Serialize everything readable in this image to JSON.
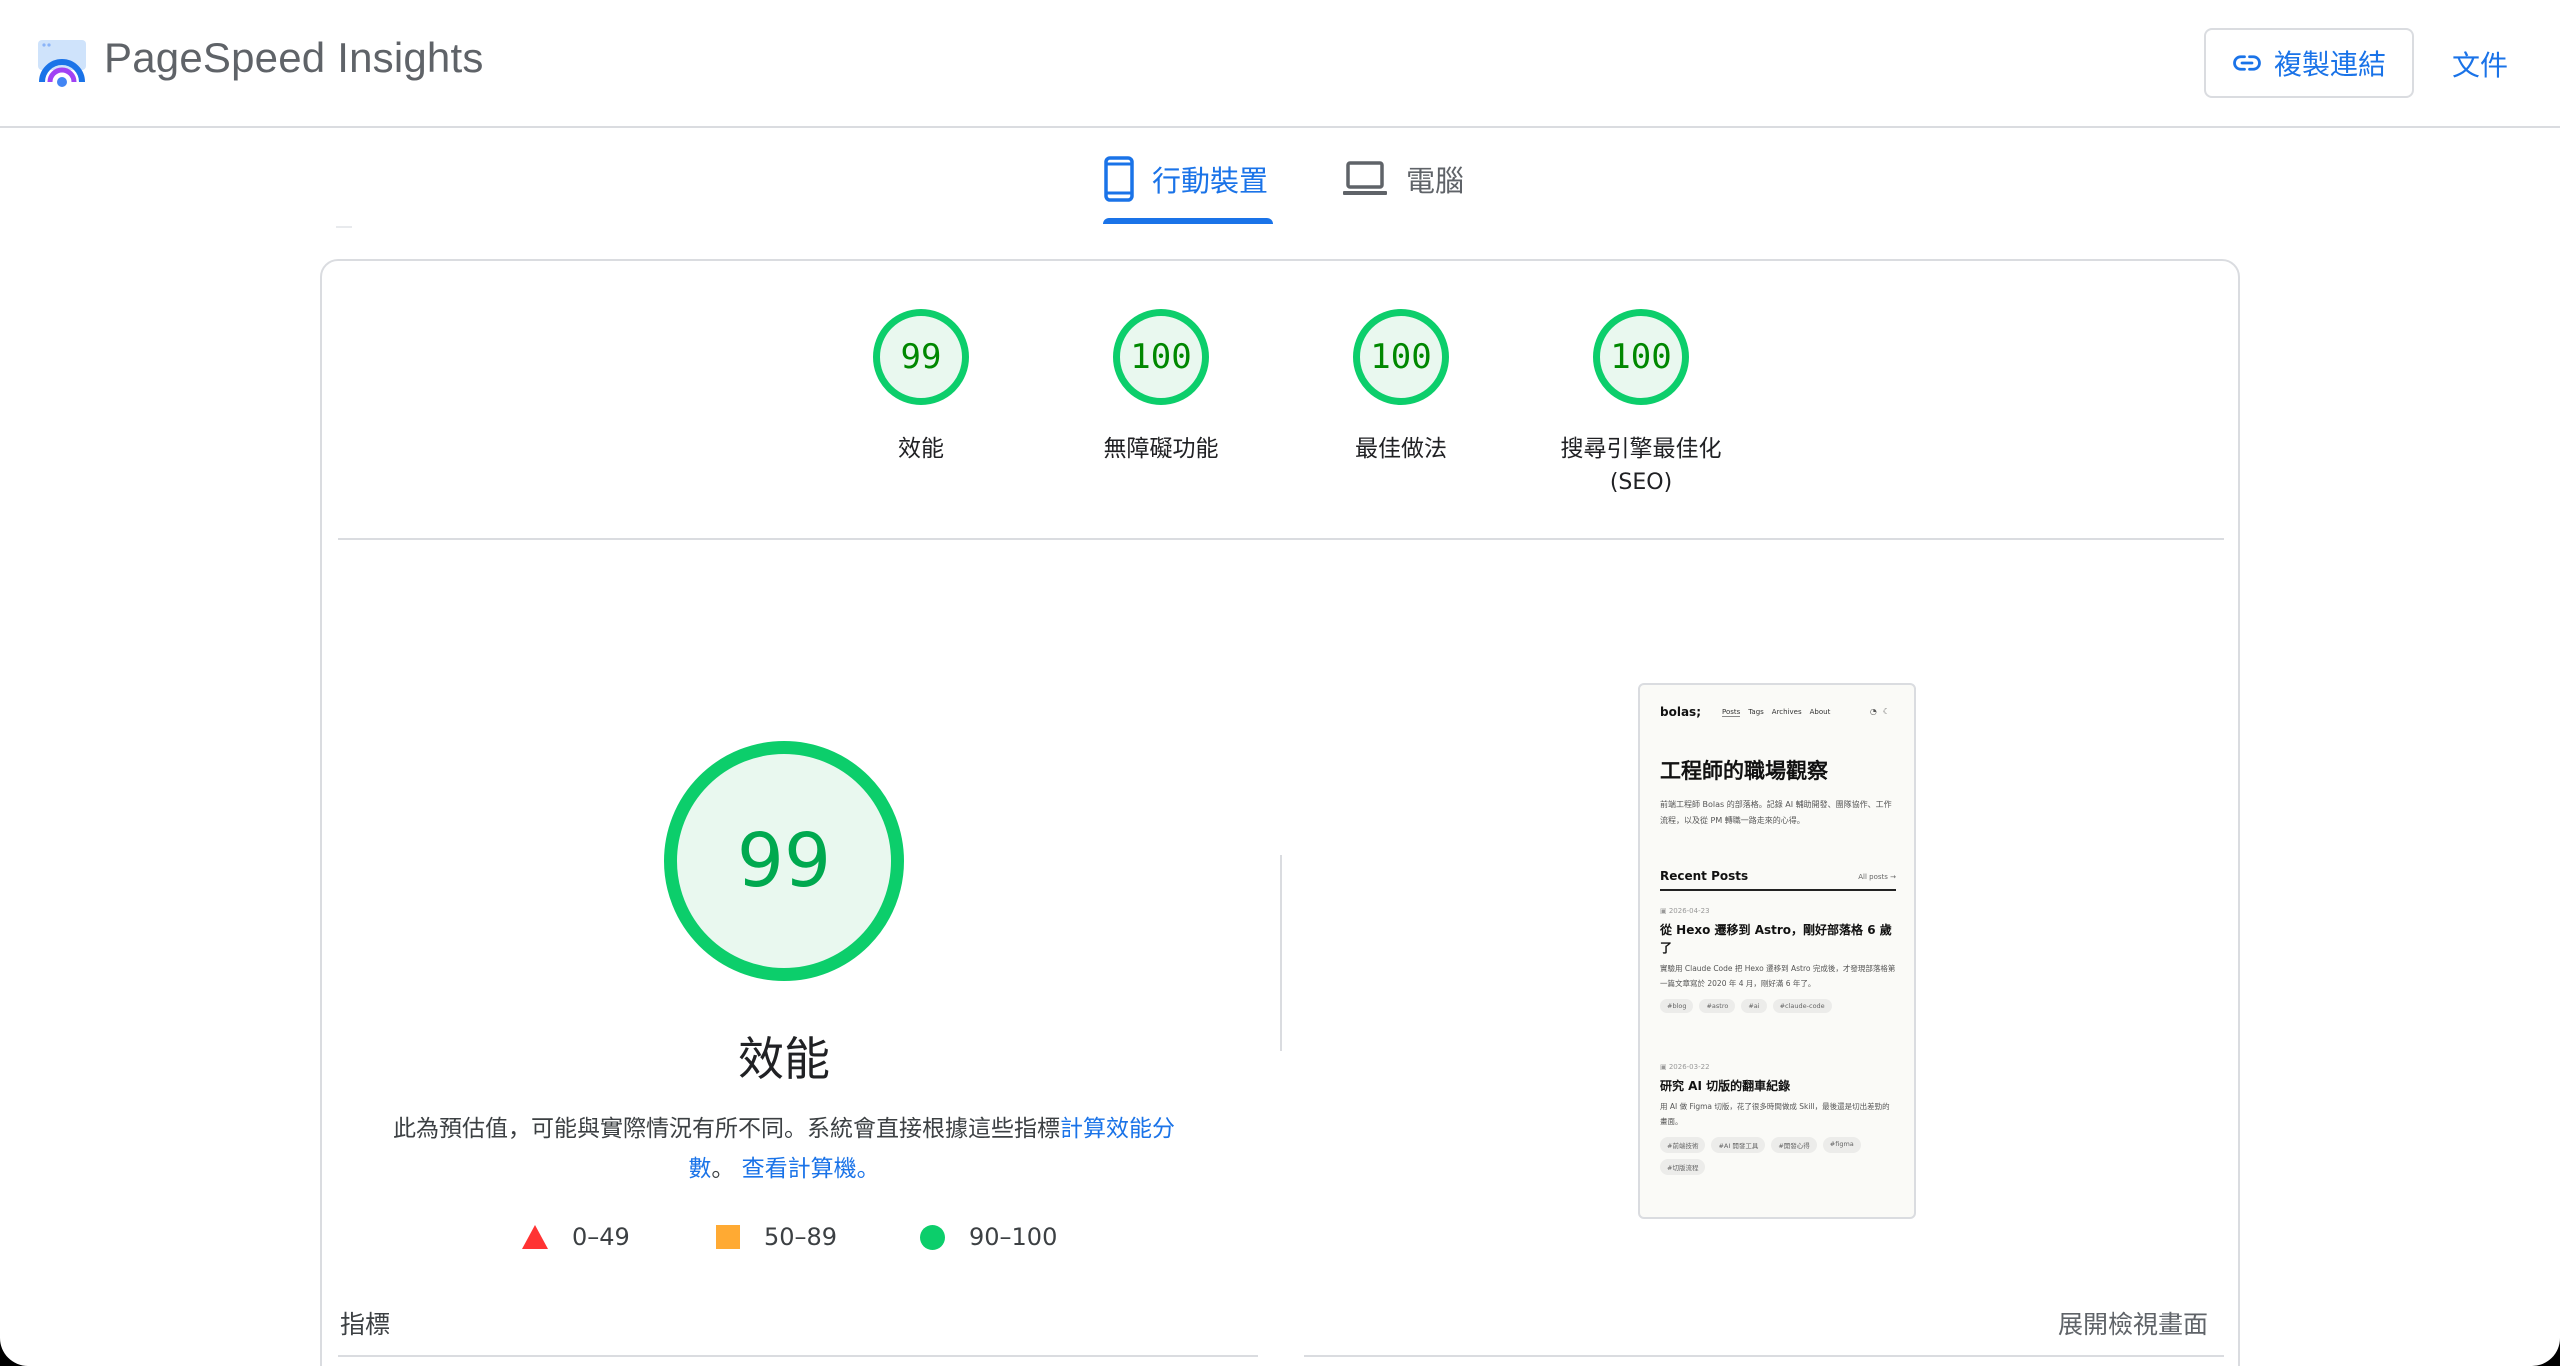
{
  "header": {
    "brand": "PageSpeed Insights",
    "copy_link_label": "複製連結",
    "docs_label": "文件",
    "icons": {
      "logo": "pagespeed-logo",
      "copy": "link-icon"
    }
  },
  "tabs": [
    {
      "label": "行動裝置",
      "icon": "smartphone-icon",
      "selected": true
    },
    {
      "label": "電腦",
      "icon": "laptop-icon",
      "selected": false
    }
  ],
  "categories": [
    {
      "score": "99",
      "label": "效能"
    },
    {
      "score": "100",
      "label": "無障礙功能"
    },
    {
      "score": "100",
      "label": "最佳做法"
    },
    {
      "score": "100",
      "label": "搜尋引擎最佳化",
      "label_line2": "(SEO)"
    }
  ],
  "performance": {
    "score": "99",
    "title": "效能",
    "desc_prefix": "此為預估值，可能與實際情況有所不同。系統會直接根據這些指標",
    "desc_link1": "計算效能分數",
    "desc_sep": "。",
    "desc_link2": "查看計算機。",
    "legend": [
      {
        "range": "0–49",
        "shape": "triangle",
        "color": "#ff3333"
      },
      {
        "range": "50–89",
        "shape": "square",
        "color": "#ffaa33"
      },
      {
        "range": "90–100",
        "shape": "circle",
        "color": "#0cce6b"
      }
    ]
  },
  "screenshot": {
    "logo": "bolas;",
    "nav": [
      "Posts",
      "Tags",
      "Archives",
      "About"
    ],
    "title": "工程師的職場觀察",
    "desc": "前端工程師 Bolas 的部落格。記錄 AI 輔助開發、團隊協作、工作流程，以及從 PM 轉職一路走來的心得。",
    "recent_label": "Recent Posts",
    "all_posts": "All posts →",
    "posts": [
      {
        "date": "2026-04-23",
        "title": "從 Hexo 遷移到 Astro，剛好部落格 6 歲了",
        "desc": "實驗用 Claude Code 把 Hexo 遷移到 Astro 完成後，才發現部落格第一篇文章寫於 2020 年 4 月，剛好滿 6 年了。",
        "tags": [
          "#blog",
          "#astro",
          "#ai",
          "#claude-code"
        ]
      },
      {
        "date": "2026-03-22",
        "title": "研究 AI 切版的翻車紀錄",
        "desc": "用 AI 做 Figma 切版，花了很多時間做成 Skill，最後還是切出差勁的畫面。",
        "tags": [
          "#前端技術",
          "#AI 開發工具",
          "#開發心得",
          "#figma",
          "#切版流程"
        ]
      }
    ]
  },
  "metrics": {
    "label": "指標",
    "expand_label": "展開檢視畫面"
  },
  "colors": {
    "accent": "#1a73e8",
    "pass": "#0cce6b",
    "pass_text": "#008800",
    "pass_fill": "#e9f8ef"
  }
}
